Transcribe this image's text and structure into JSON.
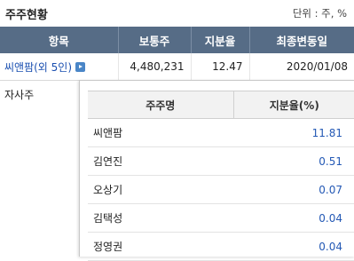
{
  "header": {
    "title": "주주현황",
    "unit": "단위 : 주, %"
  },
  "table": {
    "columns": [
      "항목",
      "보통주",
      "지분율",
      "최종변동일"
    ],
    "rows": [
      {
        "item": "씨앤팜(외 5인)",
        "shares": "4,480,231",
        "ratio": "12.47",
        "date": "2020/01/08"
      },
      {
        "item": "자사주",
        "shares": "",
        "ratio": "",
        "date": ""
      }
    ]
  },
  "popup": {
    "columns": [
      "주주명",
      "지분율(%)"
    ],
    "rows": [
      {
        "name": "씨앤팜",
        "pct": "11.81"
      },
      {
        "name": "김연진",
        "pct": "0.51"
      },
      {
        "name": "오상기",
        "pct": "0.07"
      },
      {
        "name": "김택성",
        "pct": "0.04"
      },
      {
        "name": "정영권",
        "pct": "0.04"
      }
    ]
  },
  "colors": {
    "header_bg": "#566c86",
    "link": "#1a4fb0",
    "pct": "#2459b5",
    "expand_button": "#4a86c7"
  },
  "icons": {
    "expand": "expand-arrow-icon"
  }
}
